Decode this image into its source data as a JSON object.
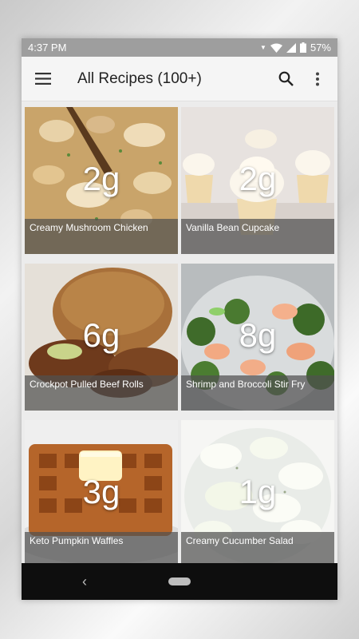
{
  "status_bar": {
    "time": "4:37 PM",
    "battery": "57%"
  },
  "app_bar": {
    "title": "All Recipes (100+)",
    "menu_icon": "hamburger-menu-icon",
    "search_icon": "search-icon",
    "more_icon": "more-vert-icon"
  },
  "recipes": [
    {
      "name": "Creamy Mushroom Chicken",
      "carbs": "2g"
    },
    {
      "name": "Vanilla Bean Cupcake",
      "carbs": "2g"
    },
    {
      "name": "Crockpot Pulled Beef Rolls",
      "carbs": "6g"
    },
    {
      "name": "Shrimp and Broccoli Stir Fry",
      "carbs": "8g"
    },
    {
      "name": "Keto Pumpkin Waffles",
      "carbs": "3g"
    },
    {
      "name": "Creamy Cucumber Salad",
      "carbs": "1g"
    }
  ],
  "nav_bar": {
    "back_icon": "back-triangle-icon",
    "home_icon": "home-pill-icon"
  }
}
